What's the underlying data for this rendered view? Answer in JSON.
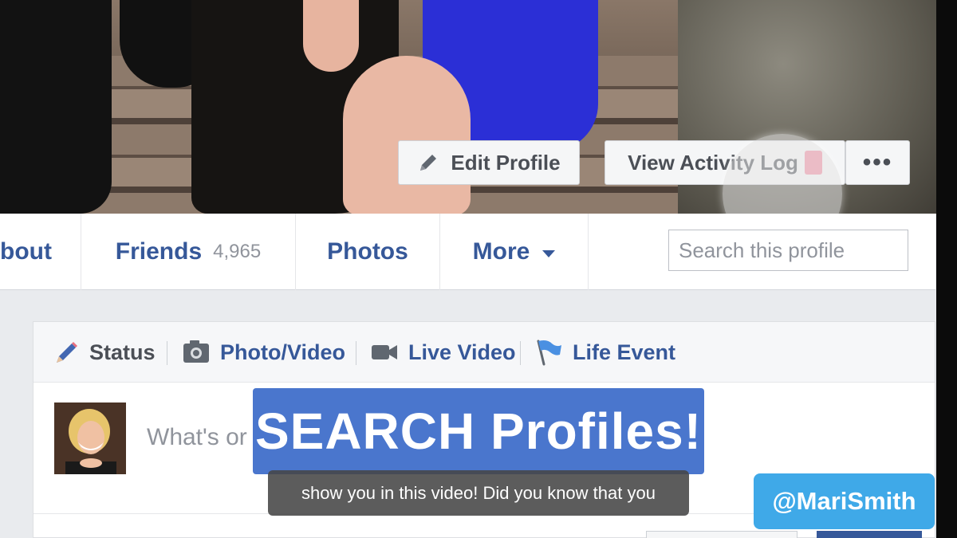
{
  "cover": {
    "edit_profile": "Edit Profile",
    "view_activity_log": "View Activity Log",
    "more_options": "•••"
  },
  "nav": {
    "about": "bout",
    "friends": "Friends",
    "friends_count": "4,965",
    "photos": "Photos",
    "more": "More",
    "search_placeholder": "Search this profile"
  },
  "composer": {
    "tabs": [
      {
        "label": "Status",
        "icon": "pencil-icon"
      },
      {
        "label": "Photo/Video",
        "icon": "camera-icon"
      },
      {
        "label": "Live Video",
        "icon": "video-camera-icon"
      },
      {
        "label": "Life Event",
        "icon": "flag-icon"
      }
    ],
    "prompt": "What's or"
  },
  "overlay": {
    "banner": "SEARCH Profiles!",
    "caption": "show you in this video! Did you know that you",
    "handle": "@MariSmith"
  },
  "colors": {
    "link_blue": "#365899",
    "banner_blue": "#4a76cd",
    "handle_blue": "#3fa9e8"
  }
}
